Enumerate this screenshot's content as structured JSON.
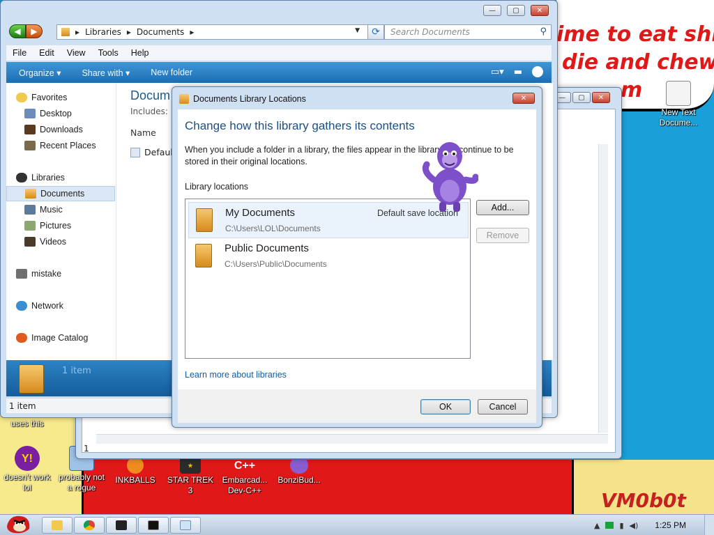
{
  "wallpaper": {
    "banner_lines": [
      "ime to eat shit",
      "die and chew",
      "m"
    ],
    "signature": "VM0b0t",
    "colors": {
      "sky": "#1aa0d8",
      "red": "#e01818",
      "yellow": "#f7ea8c"
    }
  },
  "desktop_icons": [
    {
      "label": "New Text Docume...",
      "icon": "text-document-icon"
    },
    {
      "label": "uses this",
      "icon": ""
    },
    {
      "label": "doesn't work lol",
      "icon": "yahoo-messenger-icon"
    },
    {
      "label": "probably not a rogue",
      "icon": "installer-icon"
    },
    {
      "label": "INKBALLS",
      "icon": "inkball-icon"
    },
    {
      "label": "STAR TREK 3",
      "icon": "star-trek-icon"
    },
    {
      "label": "Embarcad... Dev-C++",
      "icon": "dev-cpp-icon",
      "glyph": "C++"
    },
    {
      "label": "BonziBud...",
      "icon": "bonzi-icon"
    }
  ],
  "explorer": {
    "address": {
      "crumbs": [
        "Libraries",
        "Documents"
      ]
    },
    "search_placeholder": "Search Documents",
    "menu": [
      "File",
      "Edit",
      "View",
      "Tools",
      "Help"
    ],
    "commands": [
      "Organize ▾",
      "Share with ▾",
      "New folder"
    ],
    "nav": {
      "favorites_header": "Favorites",
      "favorites": [
        "Desktop",
        "Downloads",
        "Recent Places"
      ],
      "libraries_header": "Libraries",
      "libraries": [
        "Documents",
        "Music",
        "Pictures",
        "Videos"
      ],
      "other": [
        "mistake",
        "Network",
        "Image Catalog"
      ],
      "selected": "Documents"
    },
    "content": {
      "title": "Docum",
      "includes": "Includes:",
      "column": "Name",
      "item": "Default"
    },
    "details": {
      "text": "1 item"
    },
    "status": "1 item"
  },
  "back_window": {
    "left_marker": "1"
  },
  "dialog": {
    "title": "Documents Library Locations",
    "heading": "Change how this library gathers its contents",
    "description": "When you include a folder in a library, the files appear in the library but continue to be stored in their original locations.",
    "locations_label": "Library locations",
    "locations": [
      {
        "name": "My Documents",
        "path": "C:\\Users\\LOL\\Documents",
        "tag": "Default save location"
      },
      {
        "name": "Public Documents",
        "path": "C:\\Users\\Public\\Documents",
        "tag": ""
      }
    ],
    "buttons": {
      "add": "Add...",
      "remove": "Remove",
      "ok": "OK",
      "cancel": "Cancel"
    },
    "learn_more": "Learn more about libraries"
  },
  "taskbar": {
    "pinned": [
      "explorer-icon",
      "chrome-icon",
      "7zip-icon",
      "cmd-icon",
      "notepad-icon"
    ],
    "clock": "1:25 PM"
  }
}
